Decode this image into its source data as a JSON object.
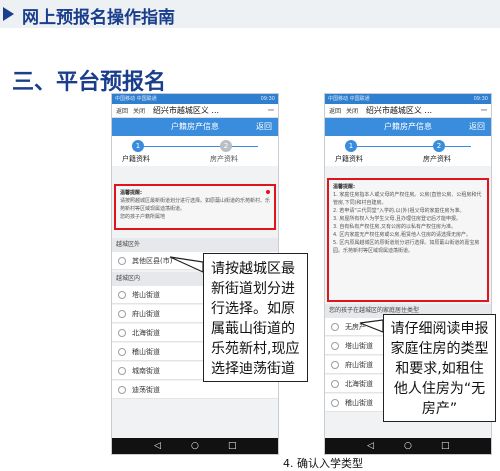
{
  "slide": {
    "header": "网上预报名操作指南",
    "title": "三、平台预报名",
    "caption": "4. 确认入学类型"
  },
  "phones": {
    "common": {
      "status_left": "中国移动 中国联通",
      "status_time": "09:30",
      "nav_back": "返回",
      "nav_close": "关闭",
      "app_title": "绍兴市越城区义 ...",
      "menu_dots": "⋯",
      "page_title": "户籍房产信息",
      "page_back": "返回",
      "step1_num": "1",
      "step1_label": "户籍资料",
      "step2_num": "2",
      "step2_label": "房产资料"
    },
    "left": {
      "notice_title": "温馨提醒:",
      "notice_text": "请按照越城区最新街道划分进行选择。如原蕺山街道的乐苑新村、乐苑新村等区域现属迪荡街道。",
      "notice_tail": "您的孩子户籍所属地",
      "section_outside": "越城区外",
      "outside_items": [
        "其他区县(市)"
      ],
      "section_inside": "越城区内",
      "inside_items": [
        "塔山街道",
        "府山街道",
        "北海街道",
        "稽山街道",
        "城南街道",
        "迪荡街道"
      ]
    },
    "right": {
      "notice_title": "温馨提醒:",
      "notice_lines": [
        "1. 家庭住房指本人或父母的产权住房。公房(直管公房、公租房和代管房,下同)和村自建房。",
        "2. 若申请\"三代同堂\"入学的,以(外)祖父母的家庭住房为准。",
        "3. 房屋所有权人为学生父母,且办理住房登记后才能申报。",
        "3. 自有私有产权住房,又有公房的以私有产权住房为准。",
        "4. 区内家庭无产权住房或公房,租赁他人住房的请选择无房产。",
        "5. 区内原属越城区的原街道划分进行选择。如原蕺山街道的嘉宝房园。乐苑新村等区域现属迪荡街道。"
      ],
      "notice_tail": "您的孩子在越城区的家庭居住类型",
      "items": [
        "无房产",
        "塔山街道",
        "府山街道",
        "北海街道",
        "稽山街道"
      ]
    },
    "nav_icons": [
      "◁",
      "○",
      "□"
    ]
  },
  "callouts": {
    "left": "请按越城区最新街道划分进行选择。如原属蕺山街道的乐苑新村,现应选择迪荡街道",
    "right": "请仔细阅读申报家庭住房的类型和要求,如租住他人住房为“无房产”"
  },
  "colors": {
    "accent": "#3a8ddd",
    "highlight": "#e0151b",
    "heading": "#1a3e8c"
  }
}
